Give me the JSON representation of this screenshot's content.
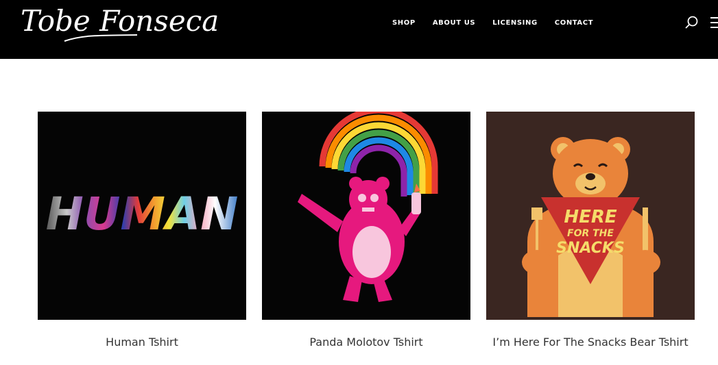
{
  "brand": {
    "logo_text": "Tobe Fonseca"
  },
  "nav": {
    "items": [
      "SHOP",
      "ABOUT US",
      "LICENSING",
      "CONTACT"
    ]
  },
  "icons": {
    "search": "search-icon",
    "menu": "hamburger-menu-icon"
  },
  "products": [
    {
      "title": "Human Tshirt",
      "art_text": "HUMAN",
      "bg": "#050505"
    },
    {
      "title": "Panda Molotov Tshirt",
      "bg": "#050505"
    },
    {
      "title": "I’m Here For The Snacks Bear Tshirt",
      "art_text": [
        "HERE",
        "FOR THE",
        "SNACKS"
      ],
      "bg": "#3a2621"
    }
  ],
  "colors": {
    "header_bg": "#000000",
    "page_bg": "#ffffff",
    "text": "#333333"
  }
}
